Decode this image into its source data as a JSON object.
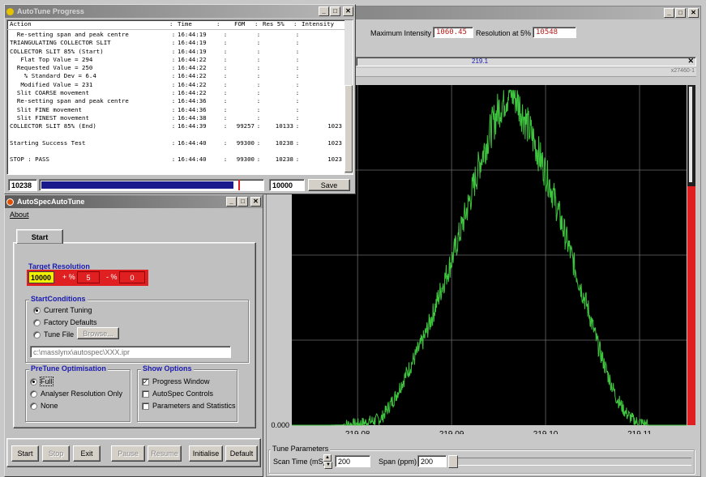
{
  "graph_window": {
    "max_intensity_label": "Maximum Intensity",
    "max_intensity_value": "1060.45",
    "resolution_label": "Resolution at 5%",
    "resolution_value": "10548",
    "center_mass": "219.1",
    "counter": "x27460-1",
    "chart_data": {
      "type": "line",
      "title": "",
      "x_ticks": [
        "219.08",
        "219.09",
        "219.10",
        "219.11"
      ],
      "y_ticks": [
        "0.000"
      ],
      "xlim": [
        219.073,
        219.115
      ],
      "ylim": [
        0,
        1060.45
      ],
      "series": [
        {
          "x": [
            219.077,
            219.08,
            219.0825,
            219.084,
            219.0855,
            219.087,
            219.088,
            219.089,
            219.09,
            219.091,
            219.092,
            219.093,
            219.094,
            219.095,
            219.0958,
            219.0962,
            219.0968,
            219.0975,
            219.0985,
            219.0995,
            219.1005,
            219.1015,
            219.1025,
            219.1035,
            219.1045,
            219.1055,
            219.1065,
            219.1075,
            219.1085,
            219.1095,
            219.111,
            219.115
          ],
          "y": [
            0,
            2,
            20,
            90,
            180,
            270,
            350,
            440,
            520,
            620,
            720,
            830,
            920,
            1000,
            1040,
            1060,
            1040,
            990,
            920,
            840,
            760,
            660,
            560,
            460,
            370,
            260,
            170,
            90,
            40,
            12,
            0,
            0
          ]
        }
      ]
    },
    "tune_parameters": {
      "title": "Tune Parameters",
      "scan_time_label": "Scan Time (mS)",
      "scan_time_value": "200",
      "span_label": "Span (ppm)",
      "span_value": "200"
    }
  },
  "progress_window": {
    "title": "AutoTune Progress",
    "header": {
      "action": "Action",
      "time": "Time",
      "fom": "FOM",
      "res": "Res 5%",
      "intensity": "Intensity"
    },
    "rows": [
      {
        "action": "  Re-setting span and peak centre",
        "time": "16:44:19",
        "fom": "",
        "res": "",
        "intensity": ""
      },
      {
        "action": "TRIANGULATING COLLECTOR SLIT",
        "time": "16:44:19",
        "fom": "",
        "res": "",
        "intensity": ""
      },
      {
        "action": "COLLECTOR SLIT 85% (Start)",
        "time": "16:44:19",
        "fom": "",
        "res": "",
        "intensity": ""
      },
      {
        "action": "   Flat Top Value = 294",
        "time": "16:44:22",
        "fom": "",
        "res": "",
        "intensity": ""
      },
      {
        "action": "  Requested Value = 250",
        "time": "16:44:22",
        "fom": "",
        "res": "",
        "intensity": ""
      },
      {
        "action": "    % Standard Dev = 6.4",
        "time": "16:44:22",
        "fom": "",
        "res": "",
        "intensity": ""
      },
      {
        "action": "   Modified Value = 231",
        "time": "16:44:22",
        "fom": "",
        "res": "",
        "intensity": ""
      },
      {
        "action": "  Slit COARSE movement",
        "time": "16:44:22",
        "fom": "",
        "res": "",
        "intensity": ""
      },
      {
        "action": "  Re-setting span and peak centre",
        "time": "16:44:36",
        "fom": "",
        "res": "",
        "intensity": ""
      },
      {
        "action": "  Slit FINE movement",
        "time": "16:44:36",
        "fom": "",
        "res": "",
        "intensity": ""
      },
      {
        "action": "  Slit FINEST movement",
        "time": "16:44:38",
        "fom": "",
        "res": "",
        "intensity": ""
      },
      {
        "action": "COLLECTOR SLIT 85% (End)",
        "time": "16:44:39",
        "fom": "99257",
        "res": "10133",
        "intensity": "1023"
      },
      {
        "action": "",
        "time": "",
        "fom": "",
        "res": "",
        "intensity": ""
      },
      {
        "action": "Starting Success Test",
        "time": "16:44:40",
        "fom": "99300",
        "res": "10238",
        "intensity": "1023"
      },
      {
        "action": "",
        "time": "",
        "fom": "",
        "res": "",
        "intensity": ""
      },
      {
        "action": "STOP : PASS",
        "time": "16:44:40",
        "fom": "99300",
        "res": "10238",
        "intensity": "1023"
      }
    ],
    "left_value": "10238",
    "right_value": "10000",
    "save_label": "Save",
    "progress_fraction": 0.87
  },
  "autospec_window": {
    "title": "AutoSpecAutoTune",
    "menu_about": "About",
    "tab_start": "Start",
    "target_resolution": {
      "title": "Target Resolution",
      "value": "10000",
      "plus_label": "+ %",
      "plus_value": "5",
      "minus_label": "- %",
      "minus_value": "0"
    },
    "start_conditions": {
      "title": "StartConditions",
      "options": [
        "Current Tuning",
        "Factory Defaults",
        "Tune File"
      ],
      "selected": 0,
      "browse_label": "Browse...",
      "path": "c:\\masslynx\\autospec\\XXX.ipr"
    },
    "pretune": {
      "title": "PreTune Optimisation",
      "options": [
        "Full",
        "Analyser Resolution Only",
        "None"
      ],
      "selected": 0
    },
    "show_options": {
      "title": "Show Options",
      "items": [
        {
          "label": "Progress Window",
          "checked": true
        },
        {
          "label": "AutoSpec Controls",
          "checked": false
        },
        {
          "label": "Parameters and Statistics",
          "checked": false
        }
      ]
    },
    "buttons": {
      "start": "Start",
      "stop": "Stop",
      "exit": "Exit",
      "pause": "Pause",
      "resume": "Resume",
      "initialise": "Initialise",
      "default": "Default"
    }
  },
  "colors": {
    "trace": "#3ec43e",
    "plot_bg": "#000000",
    "red_fill": "#e02020",
    "value_red": "#b81818",
    "group_title": "#1a1ab0",
    "target_yellow": "#f2f200"
  }
}
